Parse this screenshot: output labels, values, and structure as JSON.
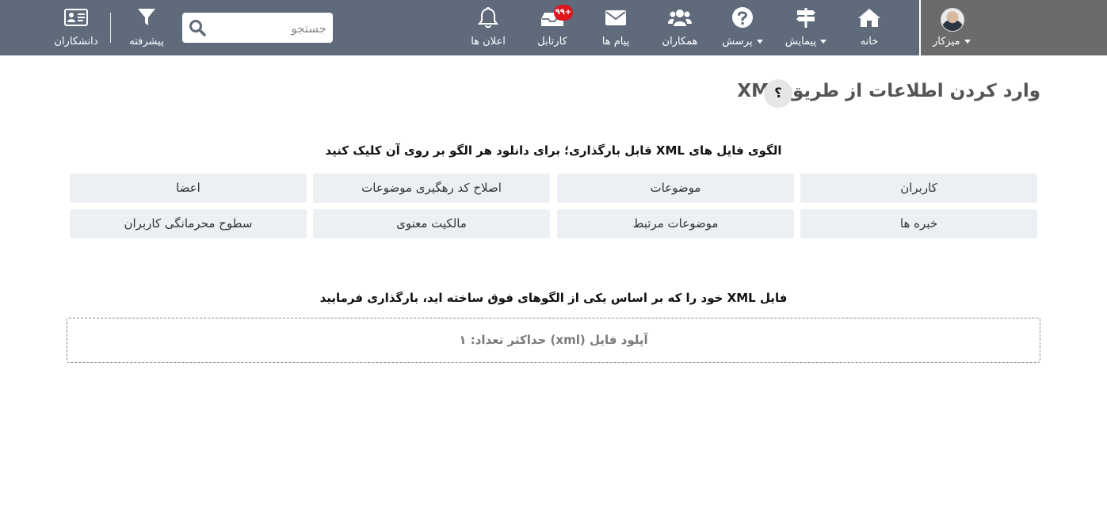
{
  "header": {
    "user": {
      "label": "میزکار"
    },
    "nav": {
      "home": "خانه",
      "survey": "پیمایش",
      "question": "پرسش",
      "colleagues": "همکاران",
      "messages": "پیام ها",
      "cartable": "کارتابل",
      "cartable_badge": "۹۹+",
      "notifications": "اعلان ها",
      "advanced": "پیشرفته",
      "scholars": "دانشکاران"
    },
    "search": {
      "placeholder": "جستجو"
    }
  },
  "page": {
    "title": "وارد کردن اطلاعات از طریق XML",
    "help": "؟",
    "templates_heading": "الگوی فایل های XML قابل بارگذاری؛ برای دانلود هر الگو بر روی آن کلیک کنید",
    "templates": [
      "کاربران",
      "موضوعات",
      "اصلاح کد رهگیری موضوعات",
      "اعضا",
      "خبره ها",
      "موضوعات مرتبط",
      "مالکیت معنوی",
      "سطوح محرمانگی کاربران"
    ],
    "upload_heading": "فایل XML خود را که بر اساس یکی از الگوهای فوق ساخته اید، بارگذاری فرمایید",
    "upload_label": "آپلود فایل (xml) حداکثر تعداد: ۱"
  },
  "colors": {
    "topbar": "#5f6b7b",
    "user_box": "#6b6b6b",
    "badge": "#e0161f",
    "template_bg": "#eceff3",
    "upload_border": "#7e8fa2"
  }
}
